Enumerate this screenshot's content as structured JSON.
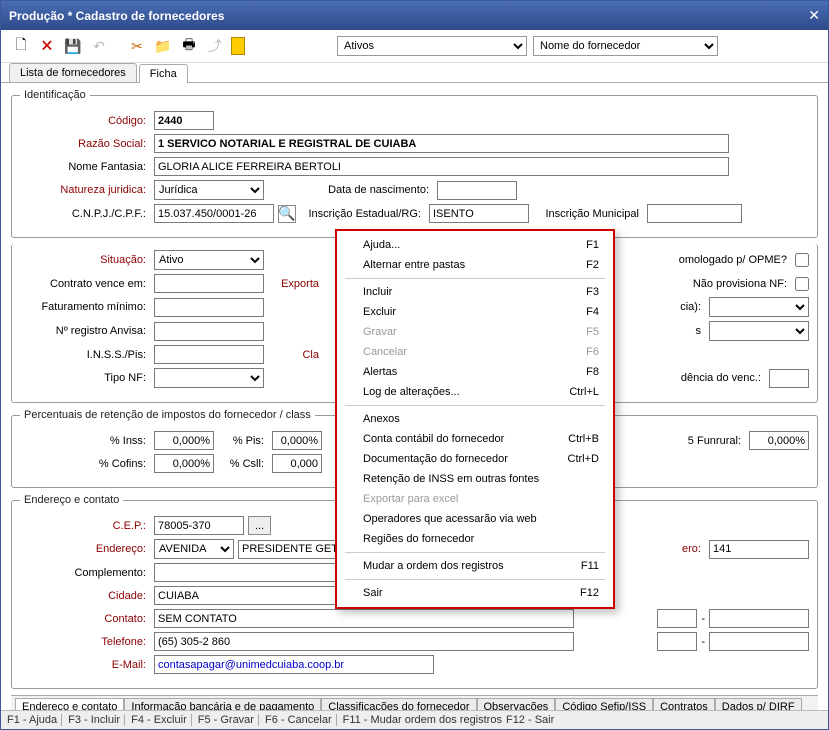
{
  "title": "Produção * Cadastro de fornecedores",
  "toolbar": {
    "filter1_selected": "Ativos",
    "filter2_selected": "Nome do fornecedor"
  },
  "tabs": {
    "list": "Lista de fornecedores",
    "ficha": "Ficha"
  },
  "ident": {
    "legend": "Identificação",
    "codigo_label": "Código:",
    "codigo": "2440",
    "razao_label": "Razão Social:",
    "razao": "1 SERVICO NOTARIAL E REGISTRAL DE CUIABA",
    "fantasia_label": "Nome Fantasia:",
    "fantasia": "GLORIA ALICE FERREIRA BERTOLI",
    "natureza_label": "Natureza juridica:",
    "natureza": "Jurídica",
    "nasc_label": "Data de nascimento:",
    "nasc": "",
    "cnpj_label": "C.N.P.J./C.P.F.:",
    "cnpj": "15.037.450/0001-26",
    "ie_label": "Inscrição Estadual/RG:",
    "ie": "ISENTO",
    "im_label": "Inscrição Municipal",
    "im": ""
  },
  "mid": {
    "situacao_label": "Situação:",
    "situacao": "Ativo",
    "exporta_label": "Exporta",
    "homolog_label": "omologado p/ OPME?",
    "contrato_label": "Contrato vence em:",
    "naoprov_label": "Não provisiona NF:",
    "fatmin_label": "Faturamento mínimo:",
    "cia_label": "cia):",
    "anvisa_label": "Nº registro Anvisa:",
    "s_label": "s",
    "inss_label": "I.N.S.S./Pis:",
    "cla_label": "Cla",
    "tiponf_label": "Tipo NF:",
    "incid_label": "dência do venc.:"
  },
  "pct": {
    "legend": "Percentuais de retenção de impostos do fornecedor / class",
    "inss_label": "% Inss:",
    "inss": "0,000%",
    "pis_label": "% Pis:",
    "pis": "0,000%",
    "fun_label": "5 Funrural:",
    "fun": "0,000%",
    "cofins_label": "% Cofins:",
    "cofins": "0,000%",
    "csll_label": "% Csll:",
    "csll": "0,000"
  },
  "addr": {
    "legend": "Endereço e contato",
    "cep_label": "C.E.P.:",
    "cep": "78005-370",
    "cep_btn": "...",
    "endereco_label": "Endereço:",
    "tipo_via": "AVENIDA",
    "rua": "PRESIDENTE GET",
    "numero_label": "ero:",
    "numero": "141",
    "compl_label": "Complemento:",
    "compl": "",
    "cidade_label": "Cidade:",
    "cidade": "CUIABA",
    "contato_label": "Contato:",
    "contato": "SEM CONTATO",
    "dash1": "-",
    "telefone_label": "Telefone:",
    "telefone": "(65) 305-2 860",
    "dash2": "-",
    "email_label": "E-Mail:",
    "email": "contasapagar@unimedcuiaba.coop.br"
  },
  "btabs": {
    "t1": "Endereço e contato",
    "t2": "Informação bancária e de pagamento",
    "t3": "Classificações do fornecedor",
    "t4": "Observações",
    "t5": "Código Sefip/ISS",
    "t6": "Contratos",
    "t7": "Dados p/ DIRF"
  },
  "status": {
    "f1": "F1 - Ajuda",
    "f3": "F3 - Incluir",
    "f4": "F4 - Excluir",
    "f5": "F5 - Gravar",
    "f6": "F6 - Cancelar",
    "f11": "F11 - Mudar ordem dos registros",
    "f12": "F12 - Sair"
  },
  "menu": [
    {
      "label": "Ajuda...",
      "key": "F1"
    },
    {
      "label": "Alternar entre pastas",
      "key": "F2"
    },
    {
      "sep": true
    },
    {
      "label": "Incluir",
      "key": "F3"
    },
    {
      "label": "Excluir",
      "key": "F4"
    },
    {
      "label": "Gravar",
      "key": "F5",
      "disabled": true
    },
    {
      "label": "Cancelar",
      "key": "F6",
      "disabled": true
    },
    {
      "label": "Alertas",
      "key": "F8"
    },
    {
      "label": "Log de alterações...",
      "key": "Ctrl+L"
    },
    {
      "sep": true
    },
    {
      "label": "Anexos",
      "key": ""
    },
    {
      "label": "Conta contábil do fornecedor",
      "key": "Ctrl+B"
    },
    {
      "label": "Documentação do fornecedor",
      "key": "Ctrl+D"
    },
    {
      "label": "Retenção de INSS em outras fontes",
      "key": ""
    },
    {
      "label": "Exportar para excel",
      "key": "",
      "disabled": true
    },
    {
      "label": "Operadores que acessarão via web",
      "key": ""
    },
    {
      "label": "Regiões do fornecedor",
      "key": ""
    },
    {
      "sep": true
    },
    {
      "label": "Mudar a ordem dos registros",
      "key": "F11"
    },
    {
      "sep": true
    },
    {
      "label": "Sair",
      "key": "F12"
    }
  ]
}
